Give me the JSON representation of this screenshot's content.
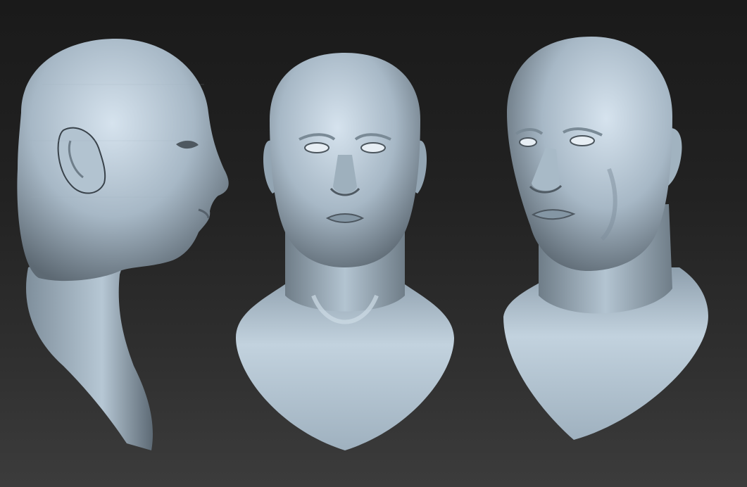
{
  "scene": {
    "background_top": "#1a1a1a",
    "background_bottom": "#3c3c3c",
    "material_light": "#c6d6e2",
    "material_mid": "#8fa2b1",
    "material_dark": "#505a63"
  },
  "busts": [
    {
      "view": "profile"
    },
    {
      "view": "front"
    },
    {
      "view": "three-quarter"
    }
  ]
}
